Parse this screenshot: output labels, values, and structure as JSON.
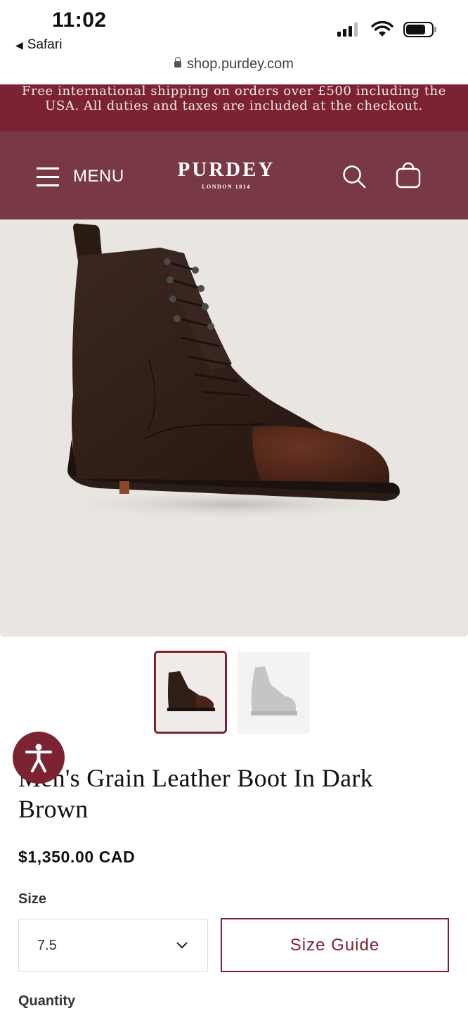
{
  "status_bar": {
    "time": "11:02",
    "back_app": "Safari"
  },
  "browser": {
    "url": "shop.purdey.com"
  },
  "promo": {
    "text": "Free international shipping on orders over £500 including the USA. All duties and taxes are included at the checkout."
  },
  "header": {
    "menu_label": "MENU",
    "brand": "PURDEY",
    "brand_sub": "LONDON 1814",
    "icons": [
      "hamburger-icon",
      "search-icon",
      "cart-icon"
    ]
  },
  "colors": {
    "accent": "#7c2333",
    "header_bg": "#783944",
    "promo_bg": "#7c2333",
    "gallery_bg": "#e9e5e1"
  },
  "product": {
    "title": "Men's Grain Leather Boot In Dark Brown",
    "price": "$1,350.00 CAD",
    "size_label": "Size",
    "size_value": "7.5",
    "size_guide_label": "Size Guide",
    "quantity_label": "Quantity"
  },
  "gallery": {
    "thumbnails": 2,
    "active_index": 0
  }
}
